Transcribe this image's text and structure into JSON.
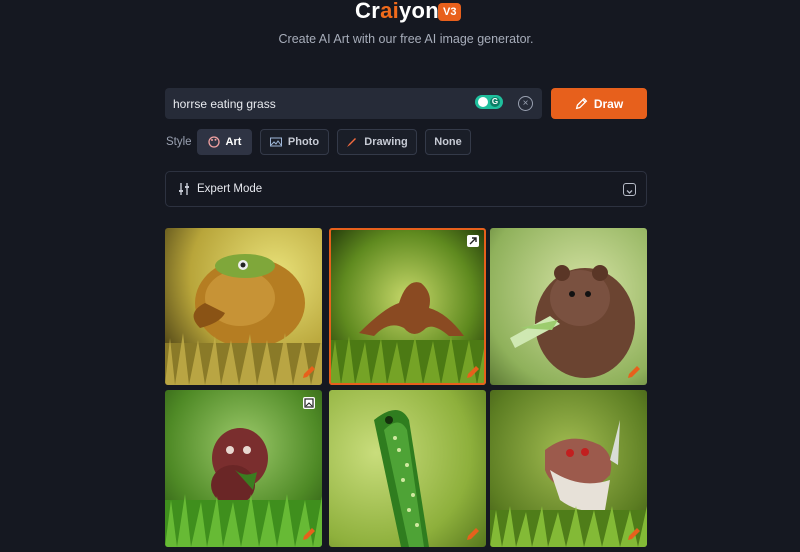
{
  "header": {
    "logo_pre": "Cr",
    "logo_ai": "ai",
    "logo_post": "yon",
    "version": "V3",
    "tagline": "Create AI Art with our free AI image generator."
  },
  "search": {
    "value": "horrse eating grass",
    "extension_icon_letter": "G"
  },
  "draw_button": {
    "label": "Draw"
  },
  "style": {
    "label": "Style",
    "options": [
      "Art",
      "Photo",
      "Drawing",
      "None"
    ],
    "selected": "Art"
  },
  "expert_mode": {
    "label": "Expert Mode"
  },
  "results": {
    "selected_index": 1,
    "images": [
      "lion-like creature in grass",
      "brown creature on green background",
      "weasel eating grass",
      "red creature on grass",
      "green spiky stalk",
      "dragon-like creature in grass"
    ]
  },
  "colors": {
    "accent": "#e7601c",
    "background": "#151821",
    "input_bg": "#262b38"
  }
}
